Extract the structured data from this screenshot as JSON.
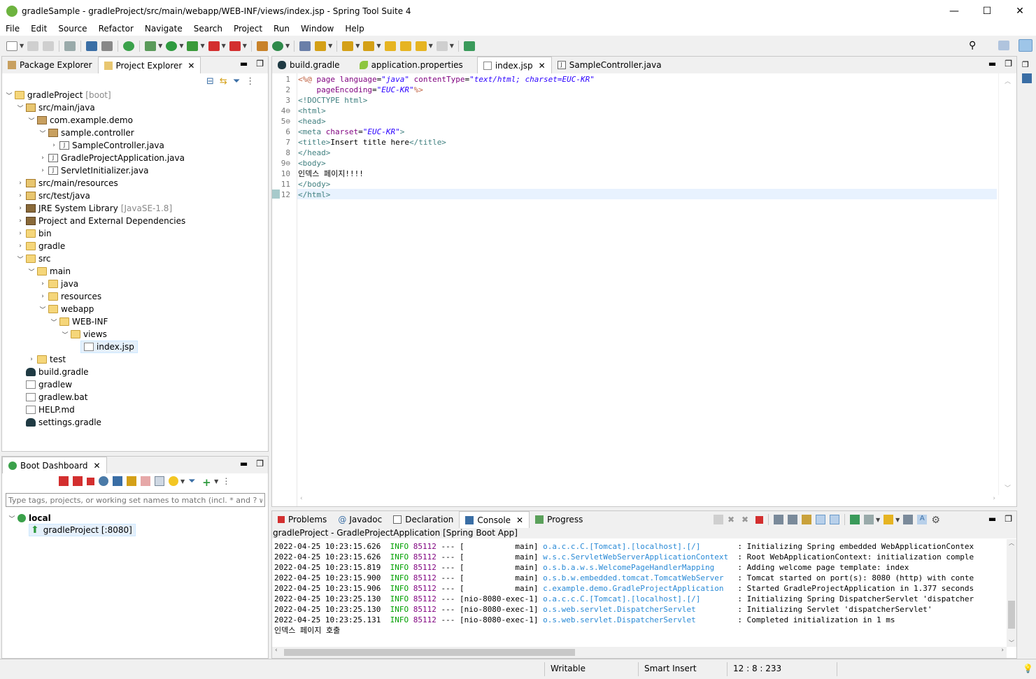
{
  "window": {
    "title": "gradleSample - gradleProject/src/main/webapp/WEB-INF/views/index.jsp - Spring Tool Suite 4",
    "minimize": "—",
    "maximize": "☐",
    "close": "✕"
  },
  "menu": [
    "File",
    "Edit",
    "Source",
    "Refactor",
    "Navigate",
    "Search",
    "Project",
    "Run",
    "Window",
    "Help"
  ],
  "explorer": {
    "tabs": [
      {
        "label": "Package Explorer"
      },
      {
        "label": "Project Explorer",
        "close": "✕"
      }
    ],
    "tree": [
      {
        "label": "gradleProject",
        "deco": "[boot]"
      },
      {
        "label": "src/main/java"
      },
      {
        "label": "com.example.demo"
      },
      {
        "label": "sample.controller"
      },
      {
        "label": "SampleController.java"
      },
      {
        "label": "GradleProjectApplication.java"
      },
      {
        "label": "ServletInitializer.java"
      },
      {
        "label": "src/main/resources"
      },
      {
        "label": "src/test/java"
      },
      {
        "label": "JRE System Library",
        "deco": "[JavaSE-1.8]"
      },
      {
        "label": "Project and External Dependencies"
      },
      {
        "label": "bin"
      },
      {
        "label": "gradle"
      },
      {
        "label": "src"
      },
      {
        "label": "main"
      },
      {
        "label": "java"
      },
      {
        "label": "resources"
      },
      {
        "label": "webapp"
      },
      {
        "label": "WEB-INF"
      },
      {
        "label": "views"
      },
      {
        "label": "index.jsp"
      },
      {
        "label": "test"
      },
      {
        "label": "build.gradle"
      },
      {
        "label": "gradlew"
      },
      {
        "label": "gradlew.bat"
      },
      {
        "label": "HELP.md"
      },
      {
        "label": "settings.gradle"
      }
    ]
  },
  "boot": {
    "tab": "Boot Dashboard",
    "close": "✕",
    "filter_placeholder": "Type tags, projects, or working set names to match (incl. * and ? wi",
    "local": "local",
    "app": "gradleProject [:8080]"
  },
  "editor": {
    "tabs": [
      {
        "label": "build.gradle"
      },
      {
        "label": "application.properties"
      },
      {
        "label": "index.jsp",
        "close": "✕"
      },
      {
        "label": "SampleController.java"
      }
    ],
    "lines": [
      {
        "n": "1",
        "fold": ""
      },
      {
        "n": "2",
        "fold": ""
      },
      {
        "n": "3",
        "fold": ""
      },
      {
        "n": "4⊖",
        "fold": ""
      },
      {
        "n": "5⊖",
        "fold": ""
      },
      {
        "n": "6",
        "fold": ""
      },
      {
        "n": "7",
        "fold": ""
      },
      {
        "n": "8",
        "fold": ""
      },
      {
        "n": "9⊖",
        "fold": ""
      },
      {
        "n": "10",
        "fold": ""
      },
      {
        "n": "11",
        "fold": ""
      },
      {
        "n": "12",
        "fold": ""
      }
    ],
    "code": {
      "l1a": "<%@ ",
      "l1b": "page ",
      "l1c": "language",
      "l1d": "=",
      "l1e": "\"java\"",
      "l1f": " contentType",
      "l1g": "=",
      "l1h": "\"text/html; charset=EUC-KR\"",
      "l2a": "    pageEncoding",
      "l2b": "=",
      "l2c": "\"EUC-KR\"",
      "l2d": "%>",
      "l3": "<!DOCTYPE html>",
      "l4": "<html>",
      "l5": "<head>",
      "l6a": "<meta ",
      "l6b": "charset",
      "l6c": "=",
      "l6d": "\"EUC-KR\"",
      "l6e": ">",
      "l7a": "<title>",
      "l7b": "Insert title here",
      "l7c": "</title>",
      "l8": "</head>",
      "l9": "<body>",
      "l10": "인덱스 페이지!!!!",
      "l11": "</body>",
      "l12": "</html>"
    }
  },
  "bottom": {
    "tabs": [
      {
        "label": "Problems"
      },
      {
        "label": "Javadoc"
      },
      {
        "label": "Declaration"
      },
      {
        "label": "Console",
        "close": "✕"
      },
      {
        "label": "Progress"
      }
    ],
    "console_title": "gradleProject - GradleProjectApplication [Spring Boot App]",
    "log": [
      {
        "ts": "2022-04-25 10:23:15.626",
        "level": "INFO",
        "pid": "85112",
        "sep": "---",
        "thread": "[           main]",
        "logger": "o.a.c.c.C.[Tomcat].[localhost].[/]",
        "msg": ": Initializing Spring embedded WebApplicationContex"
      },
      {
        "ts": "2022-04-25 10:23:15.626",
        "level": "INFO",
        "pid": "85112",
        "sep": "---",
        "thread": "[           main]",
        "logger": "w.s.c.ServletWebServerApplicationContext",
        "msg": ": Root WebApplicationContext: initialization comple"
      },
      {
        "ts": "2022-04-25 10:23:15.819",
        "level": "INFO",
        "pid": "85112",
        "sep": "---",
        "thread": "[           main]",
        "logger": "o.s.b.a.w.s.WelcomePageHandlerMapping",
        "msg": ": Adding welcome page template: index"
      },
      {
        "ts": "2022-04-25 10:23:15.900",
        "level": "INFO",
        "pid": "85112",
        "sep": "---",
        "thread": "[           main]",
        "logger": "o.s.b.w.embedded.tomcat.TomcatWebServer",
        "msg": ": Tomcat started on port(s): 8080 (http) with conte"
      },
      {
        "ts": "2022-04-25 10:23:15.906",
        "level": "INFO",
        "pid": "85112",
        "sep": "---",
        "thread": "[           main]",
        "logger": "c.example.demo.GradleProjectApplication",
        "msg": ": Started GradleProjectApplication in 1.377 seconds"
      },
      {
        "ts": "2022-04-25 10:23:25.130",
        "level": "INFO",
        "pid": "85112",
        "sep": "---",
        "thread": "[nio-8080-exec-1]",
        "logger": "o.a.c.c.C.[Tomcat].[localhost].[/]",
        "msg": ": Initializing Spring DispatcherServlet 'dispatcher"
      },
      {
        "ts": "2022-04-25 10:23:25.130",
        "level": "INFO",
        "pid": "85112",
        "sep": "---",
        "thread": "[nio-8080-exec-1]",
        "logger": "o.s.web.servlet.DispatcherServlet",
        "msg": ": Initializing Servlet 'dispatcherServlet'"
      },
      {
        "ts": "2022-04-25 10:23:25.131",
        "level": "INFO",
        "pid": "85112",
        "sep": "---",
        "thread": "[nio-8080-exec-1]",
        "logger": "o.s.web.servlet.DispatcherServlet",
        "msg": ": Completed initialization in 1 ms"
      }
    ],
    "last": "인덱스 페이지 호출"
  },
  "status": {
    "writable": "Writable",
    "mode": "Smart Insert",
    "position": "12 : 8 : 233"
  }
}
